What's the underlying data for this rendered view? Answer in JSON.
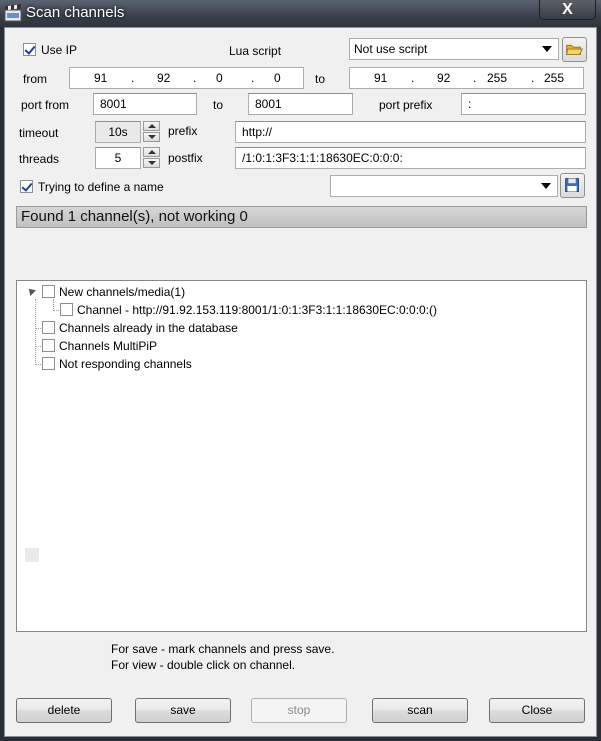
{
  "window": {
    "title": "Scan channels",
    "close_symbol": "X"
  },
  "ip": {
    "use_ip_label": "Use IP",
    "use_ip_checked": true,
    "from_label": "from",
    "from": [
      "91",
      "92",
      "0",
      "0"
    ],
    "to_label": "to",
    "to": [
      "91",
      "92",
      "255",
      "255"
    ],
    "dot": "."
  },
  "lua": {
    "label": "Lua script",
    "selected": "Not use script"
  },
  "port": {
    "from_label": "port from",
    "from_value": "8001",
    "to_label": "to",
    "to_value": "8001",
    "prefix_label": "port prefix",
    "prefix_value": ":"
  },
  "timeout": {
    "label": "timeout",
    "value": "10s"
  },
  "threads": {
    "label": "threads",
    "value": "5"
  },
  "prefix": {
    "label": "prefix",
    "value": "http://"
  },
  "postfix": {
    "label": "postfix",
    "value": "/1:0:1:3F3:1:1:18630EC:0:0:0:"
  },
  "define_name": {
    "label": "Trying to define a name",
    "checked": true,
    "selected": ""
  },
  "status_text": "Found 1 channel(s), not working 0",
  "tree": {
    "new_channels": "New channels/media(1)",
    "channel_entry": "Channel - http://91.92.153.119:8001/1:0:1:3F3:1:1:18630EC:0:0:0:()",
    "in_database": "Channels already in the database",
    "multipip": "Channels MultiPiP",
    "not_responding": "Not responding channels"
  },
  "hints": {
    "save": "For save - mark channels and press save.",
    "view": "For view - double click on channel."
  },
  "buttons": {
    "delete": "delete",
    "save": "save",
    "stop": "stop",
    "scan": "scan",
    "close": "Close"
  },
  "colors": {
    "titlebar": "#3a3f4a",
    "client_bg": "#f0f0f0",
    "status_bg": "#c8c8c8",
    "check_mark": "#21418c"
  },
  "icons": {
    "title": "clapperboard-icon",
    "open_script": "folder-open-icon",
    "save_names": "floppy-disk-icon"
  }
}
